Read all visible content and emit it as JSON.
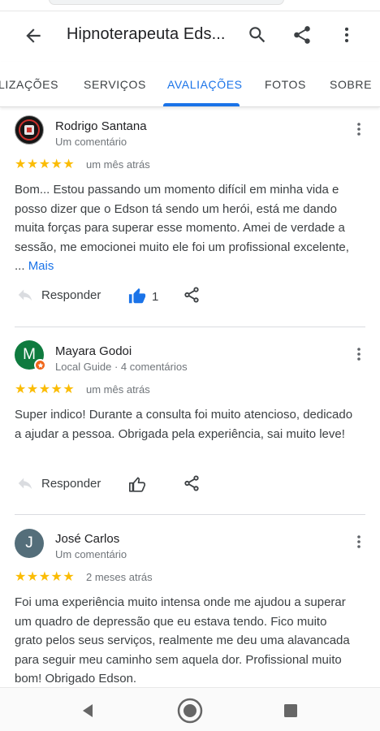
{
  "app": {
    "title": "Hipnoterapeuta Eds...",
    "icons": {
      "back": "arrow-back-icon",
      "search": "search-icon",
      "share": "share-icon",
      "more": "more-vert-icon"
    }
  },
  "tabs": [
    {
      "label": "LIZAÇÕES",
      "active": false
    },
    {
      "label": "SERVIÇOS",
      "active": false
    },
    {
      "label": "AVALIAÇÕES",
      "active": true
    },
    {
      "label": "FOTOS",
      "active": false
    },
    {
      "label": "SOBRE",
      "active": false
    }
  ],
  "colors": {
    "accent": "#1a73e8",
    "star": "#fbbc04",
    "avatar_green": "#0f7b3f",
    "avatar_slate": "#546e7a",
    "local_guide_badge": "#f0661a"
  },
  "reviews": [
    {
      "name": "Rodrigo Santana",
      "meta": "Um comentário",
      "stars": "★★★★★",
      "rating": 5,
      "time": "um mês atrás",
      "text": "Bom... Estou passando um momento difícil em minha vida e posso dizer que o Edson tá sendo um herói, está me dando muita forças para superar esse momento. Amei de verdade a sessão, me emocionei muito ele foi um profissional excelente, ...",
      "more": "Mais",
      "reply_label": "Responder",
      "likes": "1"
    },
    {
      "name": "Mayara Godoi",
      "avatar_initial": "M",
      "meta": "Local Guide · 4 comentários",
      "stars": "★★★★★",
      "rating": 5,
      "time": "um mês atrás",
      "text": "Super indico! Durante a consulta foi muito atencioso, dedicado a ajudar a pessoa. Obrigada pela experiência, sai muito leve!",
      "reply_label": "Responder"
    },
    {
      "name": "José Carlos",
      "avatar_initial": "J",
      "meta": "Um comentário",
      "stars": "★★★★★",
      "rating": 5,
      "time": "2 meses atrás",
      "text": "Foi uma experiência muito intensa onde me ajudou a superar um quadro de depressão que eu estava tendo. Fico muito grato pelos seus serviços, realmente me deu uma alavancada para seguir meu caminho sem aquela dor. Profissional muito bom! Obrigado Edson."
    }
  ],
  "nav": {
    "icons": [
      "nav-back-icon",
      "nav-home-icon",
      "nav-recents-icon"
    ]
  }
}
